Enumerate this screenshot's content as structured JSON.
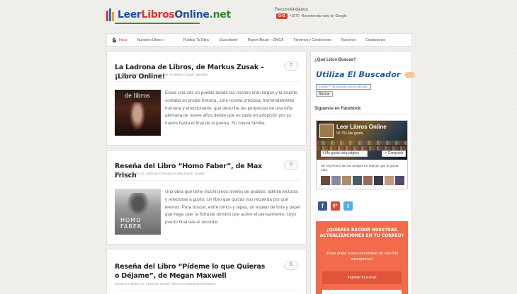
{
  "header": {
    "logo_part1": "Leer",
    "logo_part2": "Libros",
    "logo_part3": "Online",
    "logo_part4": ".net",
    "recommend_label": "Recomiéndanos",
    "gplus_label": "G+1",
    "gplus_count": "+1070",
    "gplus_text": "Recomendar esto en Google"
  },
  "nav": {
    "items": [
      "Inicio",
      "Nuestros Libros »",
      "Publica Tu Obra",
      "¡Suscríbete!",
      "Report Abuse – DMCA",
      "Términos y Condiciones",
      "Nosotros",
      "Contáctanos"
    ]
  },
  "posts": [
    {
      "title": "La Ladrona de Libros, de Markus Zusak – ¡Libro Online!",
      "meta": "Escrito en febrero 26, 2016 por Xarah en Markus Zusak, Narrativa",
      "comments": "7",
      "thumb_caption": "de libros",
      "excerpt": "Érase una vez un pueblo donde las noches eran largas y la muerte contaba su propia historia...Una novela preciosa, tremendamente humana y emocionante, que describe las peripecias de una niña alemana de nueve años desde que es dada en adopción por su madre hasta el final de la guerra. Su nueva familia,"
    },
    {
      "title": "Reseña del Libro “Homo Faber”, de Max Frisch",
      "meta": "Escrito en febrero 22, 2016 por Chispina en Max Frisch, Novela",
      "comments": "0",
      "thumb_caption": "HOMO FABER",
      "excerpt": "Una obra que tiene muchísimos niveles de análisis: admite lecturas y relecturas a gusto. Un libro que quizás nos recuerda por qué leemos: Para buscar, entre lomos y tapas, un espejo de tinta y papel que haga caer la ficha de dominó que active el pensamiento, cuyo puerto final sea el recordar"
    },
    {
      "title": "Reseña del Libro “Pídeme lo que Quieras o Déjame”, de Megan Maxwell",
      "meta": "Escrito en febrero 16, 2016 por Joseph Alberto en Literatura Romántica",
      "comments": "5"
    }
  ],
  "sidebar": {
    "search_title": "¿Qué Libro Buscas?",
    "search_banner": "Utiliza El Buscador",
    "search_placeholder": "Google™ Búsqueda personalizada",
    "search_button": "Buscar",
    "facebook_title": "Síguenos en Facebook",
    "fb_page_name": "Leer Libros Online",
    "fb_likes": "92.791 Me gusta",
    "fb_like_button": "Me gusta esta página",
    "fb_share_button": "Compartir",
    "fb_friends_text": "Sé el primero de tus amigos en indicar que te gusta esto.",
    "subscribe_title": "¿QUIERES RECIBIR NUESTRAS ACTUALIZACIONES EN TU CORREO?",
    "subscribe_text": "¡Pues únete a una comunidad de +60.000 suscriptores!",
    "subscribe_input": "Ingrese tu e-mail"
  }
}
